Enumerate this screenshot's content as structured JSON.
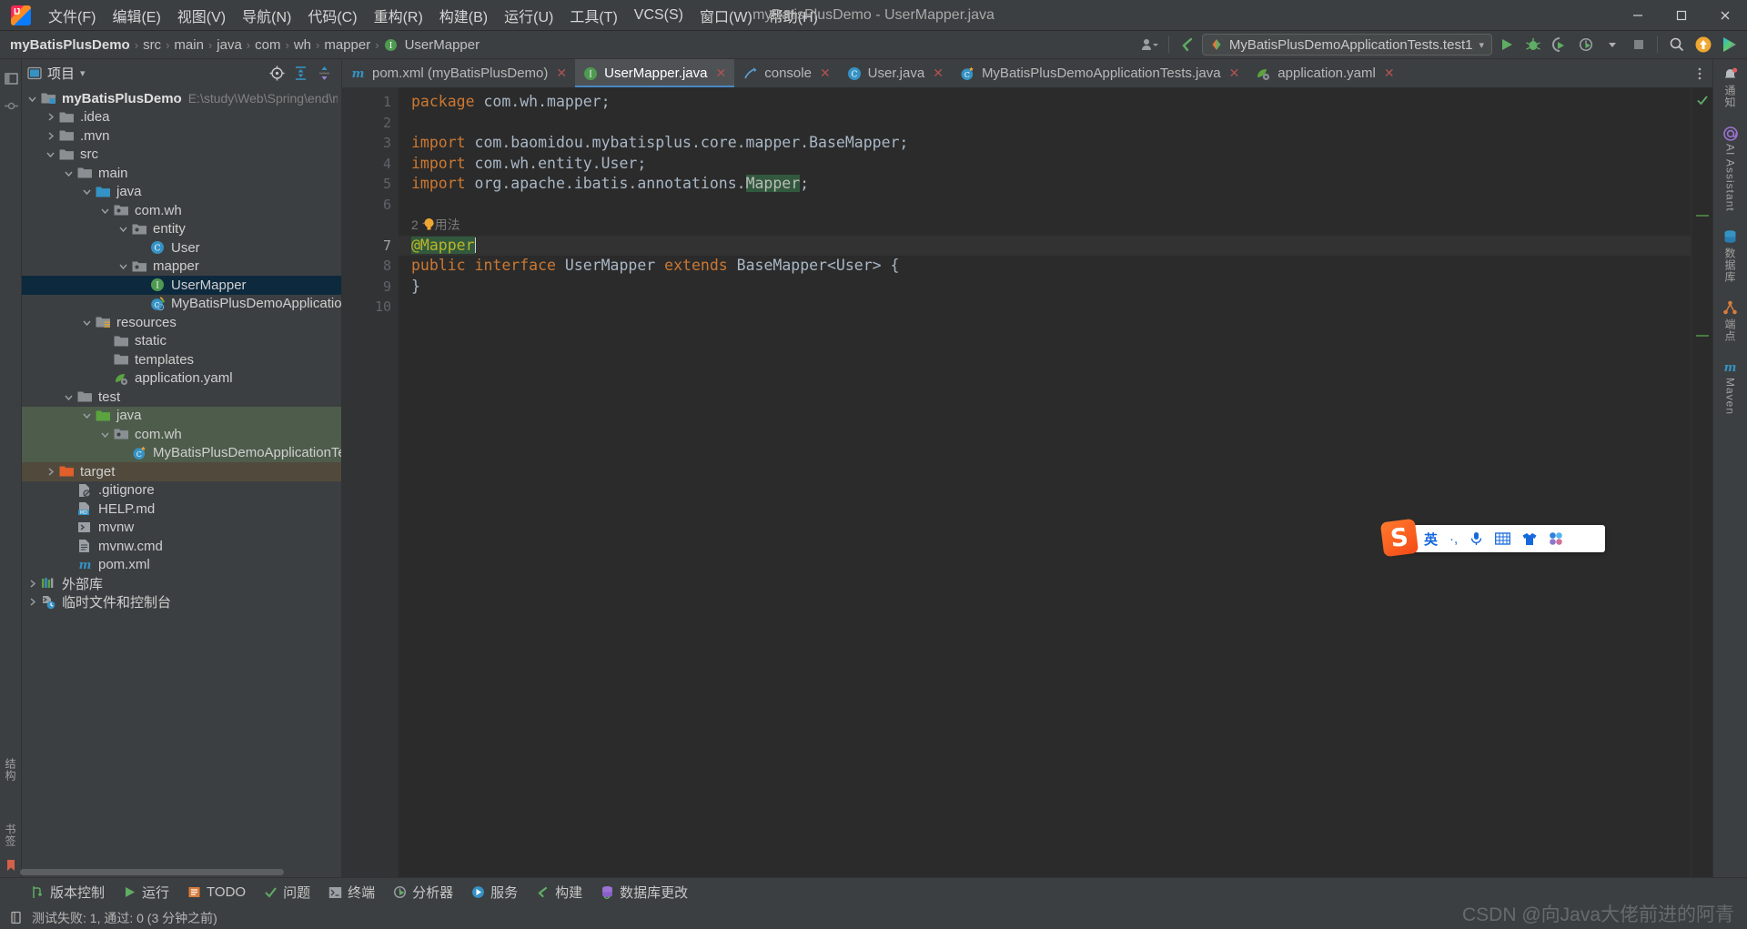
{
  "window": {
    "title": "myBatisPlusDemo - UserMapper.java",
    "minimize": "—",
    "maximize": "❐",
    "close": "✕"
  },
  "menubar": {
    "items": [
      {
        "label": "文件(F)",
        "name": "menu-file"
      },
      {
        "label": "编辑(E)",
        "name": "menu-edit"
      },
      {
        "label": "视图(V)",
        "name": "menu-view"
      },
      {
        "label": "导航(N)",
        "name": "menu-navigate"
      },
      {
        "label": "代码(C)",
        "name": "menu-code"
      },
      {
        "label": "重构(R)",
        "name": "menu-refactor"
      },
      {
        "label": "构建(B)",
        "name": "menu-build"
      },
      {
        "label": "运行(U)",
        "name": "menu-run"
      },
      {
        "label": "工具(T)",
        "name": "menu-tools"
      },
      {
        "label": "VCS(S)",
        "name": "menu-vcs"
      },
      {
        "label": "窗口(W)",
        "name": "menu-window"
      },
      {
        "label": "帮助(H)",
        "name": "menu-help"
      }
    ]
  },
  "breadcrumb": {
    "items": [
      "myBatisPlusDemo",
      "src",
      "main",
      "java",
      "com",
      "wh",
      "mapper",
      "UserMapper"
    ],
    "separator": "›"
  },
  "run_config": {
    "name": "MyBatisPlusDemoApplicationTests.test1",
    "dropdown_caret": "▾"
  },
  "project_panel": {
    "title": "项目",
    "dropdown": "▾",
    "tree": [
      {
        "label": "myBatisPlusDemo",
        "path": "E:\\study\\Web\\Spring\\end\\myBat",
        "depth": 0,
        "arrow": "v",
        "icon": "module-folder-icon",
        "bold": true
      },
      {
        "label": ".idea",
        "path": "",
        "depth": 1,
        "arrow": ">",
        "icon": "folder-icon"
      },
      {
        "label": ".mvn",
        "path": "",
        "depth": 1,
        "arrow": ">",
        "icon": "folder-icon"
      },
      {
        "label": "src",
        "path": "",
        "depth": 1,
        "arrow": "v",
        "icon": "folder-icon"
      },
      {
        "label": "main",
        "path": "",
        "depth": 2,
        "arrow": "v",
        "icon": "folder-icon"
      },
      {
        "label": "java",
        "path": "",
        "depth": 3,
        "arrow": "v",
        "icon": "source-folder-icon"
      },
      {
        "label": "com.wh",
        "path": "",
        "depth": 4,
        "arrow": "v",
        "icon": "package-icon"
      },
      {
        "label": "entity",
        "path": "",
        "depth": 5,
        "arrow": "v",
        "icon": "package-icon"
      },
      {
        "label": "User",
        "path": "",
        "depth": 6,
        "arrow": "",
        "icon": "java-class-icon"
      },
      {
        "label": "mapper",
        "path": "",
        "depth": 5,
        "arrow": "v",
        "icon": "package-icon"
      },
      {
        "label": "UserMapper",
        "path": "",
        "depth": 6,
        "arrow": "",
        "icon": "java-interface-icon",
        "selected": true
      },
      {
        "label": "MyBatisPlusDemoApplication",
        "path": "",
        "depth": 6,
        "arrow": "",
        "icon": "spring-class-icon"
      },
      {
        "label": "resources",
        "path": "",
        "depth": 3,
        "arrow": "v",
        "icon": "resource-folder-icon"
      },
      {
        "label": "static",
        "path": "",
        "depth": 4,
        "arrow": "",
        "icon": "folder-icon"
      },
      {
        "label": "templates",
        "path": "",
        "depth": 4,
        "arrow": "",
        "icon": "folder-icon"
      },
      {
        "label": "application.yaml",
        "path": "",
        "depth": 4,
        "arrow": "",
        "icon": "spring-yaml-icon"
      },
      {
        "label": "test",
        "path": "",
        "depth": 2,
        "arrow": "v",
        "icon": "folder-icon"
      },
      {
        "label": "java",
        "path": "",
        "depth": 3,
        "arrow": "v",
        "icon": "test-source-folder-icon",
        "highlight": "green"
      },
      {
        "label": "com.wh",
        "path": "",
        "depth": 4,
        "arrow": "v",
        "icon": "package-icon",
        "highlight": "green"
      },
      {
        "label": "MyBatisPlusDemoApplicationTests",
        "path": "",
        "depth": 5,
        "arrow": "",
        "icon": "test-class-icon",
        "highlight": "green"
      },
      {
        "label": "target",
        "path": "",
        "depth": 1,
        "arrow": ">",
        "icon": "excluded-folder-icon",
        "highlight": "brown"
      },
      {
        "label": ".gitignore",
        "path": "",
        "depth": 2,
        "arrow": "",
        "icon": "gitignore-file-icon"
      },
      {
        "label": "HELP.md",
        "path": "",
        "depth": 2,
        "arrow": "",
        "icon": "markdown-file-icon"
      },
      {
        "label": "mvnw",
        "path": "",
        "depth": 2,
        "arrow": "",
        "icon": "shell-script-icon"
      },
      {
        "label": "mvnw.cmd",
        "path": "",
        "depth": 2,
        "arrow": "",
        "icon": "cmd-script-icon"
      },
      {
        "label": "pom.xml",
        "path": "",
        "depth": 2,
        "arrow": "",
        "icon": "maven-pom-icon"
      },
      {
        "label": "外部库",
        "path": "",
        "depth": 0,
        "arrow": ">",
        "icon": "external-libraries-icon"
      },
      {
        "label": "临时文件和控制台",
        "path": "",
        "depth": 0,
        "arrow": ">",
        "icon": "scratches-icon"
      }
    ]
  },
  "editor_tabs": [
    {
      "label": "pom.xml (myBatisPlusDemo)",
      "icon": "maven-pom-icon",
      "active": false,
      "close": "✕"
    },
    {
      "label": "UserMapper.java",
      "icon": "java-interface-icon",
      "active": true,
      "close": "✕"
    },
    {
      "label": "console",
      "icon": "console-icon",
      "active": false,
      "close": "✕"
    },
    {
      "label": "User.java",
      "icon": "java-class-icon",
      "active": false,
      "close": "✕"
    },
    {
      "label": "MyBatisPlusDemoApplicationTests.java",
      "icon": "test-class-icon",
      "active": false,
      "close": "✕"
    },
    {
      "label": "application.yaml",
      "icon": "spring-yaml-icon",
      "active": false,
      "close": "✕"
    }
  ],
  "code": {
    "line_numbers": [
      "1",
      "2",
      "3",
      "4",
      "5",
      "6",
      "7",
      "8",
      "9",
      "10"
    ],
    "inlay_hint": "2 个用法",
    "lines": [
      {
        "n": "1",
        "tokens": [
          {
            "t": "package",
            "c": "kw"
          },
          {
            "t": " com.wh.mapper;",
            "c": "ident"
          }
        ]
      },
      {
        "n": "2",
        "tokens": []
      },
      {
        "n": "3",
        "tokens": [
          {
            "t": "import",
            "c": "kw"
          },
          {
            "t": " com.baomidou.mybatisplus.core.mapper.BaseMapper;",
            "c": "ident"
          }
        ]
      },
      {
        "n": "4",
        "tokens": [
          {
            "t": "import",
            "c": "kw"
          },
          {
            "t": " com.wh.entity.User;",
            "c": "ident"
          }
        ]
      },
      {
        "n": "5",
        "tokens": [
          {
            "t": "import",
            "c": "kw"
          },
          {
            "t": " org.apache.ibatis.annotations.",
            "c": "ident"
          },
          {
            "t": "Mapper",
            "c": "hlsearch"
          },
          {
            "t": ";",
            "c": "ident"
          }
        ]
      },
      {
        "n": "6",
        "tokens": []
      },
      {
        "n": "7",
        "tokens": [
          {
            "t": "@Mapper",
            "c": "ann hlsearch"
          }
        ],
        "current": true
      },
      {
        "n": "8",
        "tokens": [
          {
            "t": "public",
            "c": "kw"
          },
          {
            "t": " ",
            "c": "ident"
          },
          {
            "t": "interface",
            "c": "kw"
          },
          {
            "t": " UserMapper ",
            "c": "ident"
          },
          {
            "t": "extends",
            "c": "kw"
          },
          {
            "t": " BaseMapper<User> {",
            "c": "ident"
          }
        ]
      },
      {
        "n": "9",
        "tokens": [
          {
            "t": "}",
            "c": "ident"
          }
        ]
      },
      {
        "n": "10",
        "tokens": []
      }
    ]
  },
  "right_strip": [
    {
      "label": "通知",
      "icon": "notifications-bell-icon",
      "badge": true
    },
    {
      "label": "AI Assistant",
      "icon": "ai-assistant-icon"
    },
    {
      "label": "数据库",
      "icon": "database-icon"
    },
    {
      "label": "端点",
      "icon": "endpoints-icon"
    },
    {
      "label": "Maven",
      "icon": "maven-icon"
    }
  ],
  "left_strip": [
    {
      "label": "项目",
      "icon": "project-tool-window-icon"
    },
    {
      "label": "提交",
      "icon": "commit-icon"
    },
    {
      "label": "结构",
      "icon": "structure-icon"
    },
    {
      "label": "书签",
      "icon": "bookmarks-icon"
    }
  ],
  "bottom_bar": [
    {
      "label": "版本控制",
      "icon": "vcs-icon"
    },
    {
      "label": "运行",
      "icon": "run-icon"
    },
    {
      "label": "TODO",
      "icon": "todo-icon"
    },
    {
      "label": "问题",
      "icon": "problems-icon"
    },
    {
      "label": "终端",
      "icon": "terminal-icon"
    },
    {
      "label": "分析器",
      "icon": "profiler-icon"
    },
    {
      "label": "服务",
      "icon": "services-icon"
    },
    {
      "label": "构建",
      "icon": "build-icon"
    },
    {
      "label": "数据库更改",
      "icon": "database-changes-icon"
    }
  ],
  "status_bar": {
    "text": "测试失败: 1, 通过: 0 (3 分钟之前)",
    "icon": "test-status-icon"
  },
  "ime": {
    "logo": "S",
    "items": [
      "英",
      "·,",
      "mic",
      "keyboard",
      "skin",
      "apps"
    ]
  },
  "watermark": "CSDN @向Java大佬前进的阿青",
  "colors": {
    "accent_blue": "#4a88c7",
    "selection": "#0d293e",
    "green_highlight": "#4e5c4b",
    "brown_highlight": "#514a3c",
    "keyword": "#cc7832",
    "annotation": "#bbb529",
    "search_highlight": "#32593d"
  }
}
